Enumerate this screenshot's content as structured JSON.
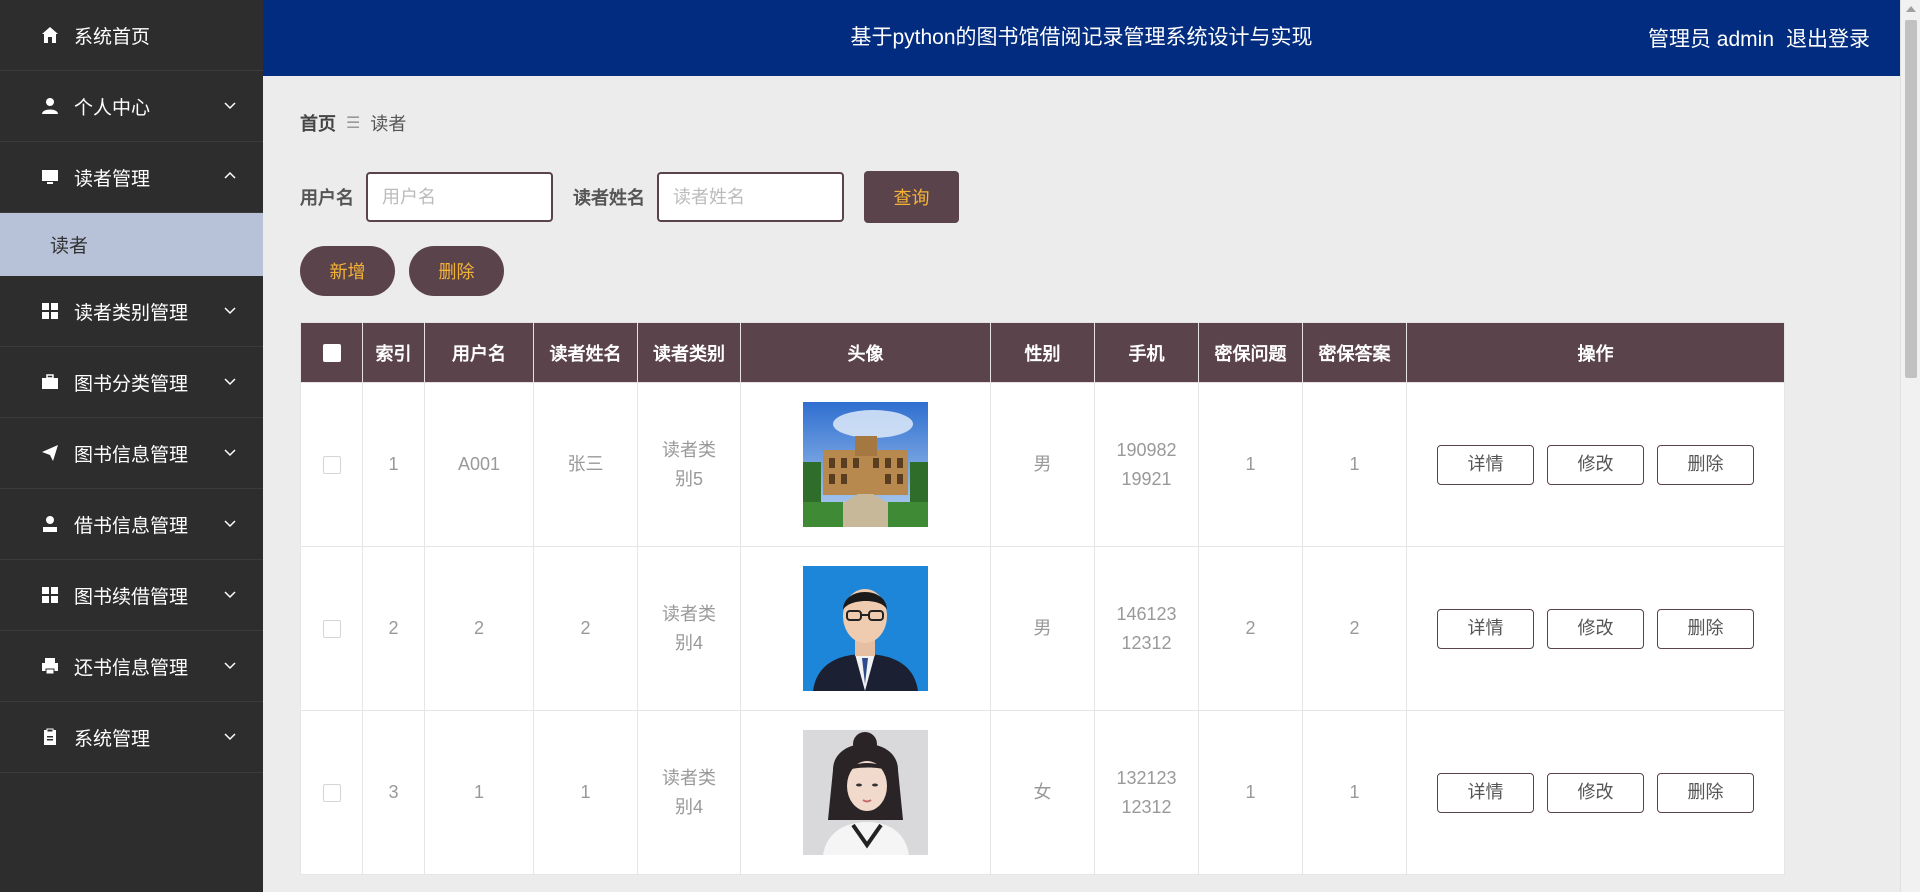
{
  "sidebar": {
    "items": [
      {
        "label": "系统首页",
        "icon": "home-icon",
        "expandable": false
      },
      {
        "label": "个人中心",
        "icon": "user-icon",
        "expandable": true
      },
      {
        "label": "读者管理",
        "icon": "monitor-icon",
        "expandable": true,
        "expanded": true,
        "children": [
          {
            "label": "读者",
            "active": true
          }
        ]
      },
      {
        "label": "读者类别管理",
        "icon": "grid-icon",
        "expandable": true
      },
      {
        "label": "图书分类管理",
        "icon": "briefcase-icon",
        "expandable": true
      },
      {
        "label": "图书信息管理",
        "icon": "paper-plane-icon",
        "expandable": true
      },
      {
        "label": "借书信息管理",
        "icon": "user-badge-icon",
        "expandable": true
      },
      {
        "label": "图书续借管理",
        "icon": "grid-icon",
        "expandable": true
      },
      {
        "label": "还书信息管理",
        "icon": "printer-icon",
        "expandable": true
      },
      {
        "label": "系统管理",
        "icon": "clipboard-icon",
        "expandable": true
      }
    ]
  },
  "header": {
    "title": "基于python的图书馆借阅记录管理系统设计与实现",
    "admin_label": "管理员 admin",
    "logout_label": "退出登录"
  },
  "breadcrumb": {
    "home": "首页",
    "separator": "☰",
    "current": "读者"
  },
  "search": {
    "username_label": "用户名",
    "username_placeholder": "用户名",
    "name_label": "读者姓名",
    "name_placeholder": "读者姓名",
    "query_label": "查询"
  },
  "actions": {
    "add_label": "新增",
    "delete_label": "删除"
  },
  "table": {
    "columns": [
      "索引",
      "用户名",
      "读者姓名",
      "读者类别",
      "头像",
      "性别",
      "手机",
      "密保问题",
      "密保答案",
      "操作"
    ],
    "op_labels": {
      "detail": "详情",
      "edit": "修改",
      "delete": "删除"
    },
    "rows": [
      {
        "index": "1",
        "username": "A001",
        "name": "张三",
        "category": "读者类别5",
        "avatar": "building-photo",
        "gender": "男",
        "phone": "19098219921",
        "question": "1",
        "answer": "1"
      },
      {
        "index": "2",
        "username": "2",
        "name": "2",
        "category": "读者类别4",
        "avatar": "man-portrait-photo",
        "gender": "男",
        "phone": "14612312312",
        "question": "2",
        "answer": "2"
      },
      {
        "index": "3",
        "username": "1",
        "name": "1",
        "category": "读者类别4",
        "avatar": "woman-portrait-photo",
        "gender": "女",
        "phone": "13212312312",
        "question": "1",
        "answer": "1"
      }
    ]
  },
  "colors": {
    "header": "#022c7f",
    "sidebar": "#2e2d2e",
    "accent": "#5b434b",
    "accent_text": "#f5b335",
    "sub_active": "#b7c2d8"
  }
}
